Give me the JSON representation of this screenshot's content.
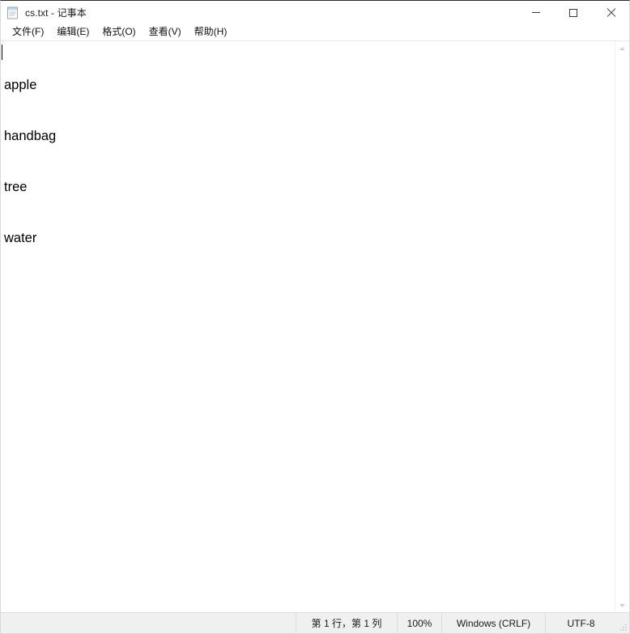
{
  "window": {
    "title": "cs.txt - 记事本",
    "icon": "notepad-document-icon"
  },
  "controls": {
    "minimize_label": "最小化",
    "maximize_label": "最大化",
    "close_label": "关闭"
  },
  "menubar": {
    "items": [
      {
        "label": "文件(F)",
        "name": "menu-file"
      },
      {
        "label": "编辑(E)",
        "name": "menu-edit"
      },
      {
        "label": "格式(O)",
        "name": "menu-format"
      },
      {
        "label": "查看(V)",
        "name": "menu-view"
      },
      {
        "label": "帮助(H)",
        "name": "menu-help"
      }
    ]
  },
  "editor": {
    "lines": [
      "apple",
      "handbag",
      "tree",
      "water"
    ],
    "text": "apple\nhandbag\ntree\nwater",
    "caret_line": 1,
    "caret_column": 1
  },
  "scrollbar": {
    "up_arrow": "chevron-up-icon",
    "down_arrow": "chevron-down-icon"
  },
  "statusbar": {
    "position": "第 1 行，第 1 列",
    "zoom": "100%",
    "line_ending": "Windows (CRLF)",
    "encoding": "UTF-8"
  },
  "colors": {
    "window_bg": "#ffffff",
    "statusbar_bg": "#f0f0f0",
    "text": "#000000",
    "border": "#dcdcdc",
    "close_hover": "#e81123"
  }
}
